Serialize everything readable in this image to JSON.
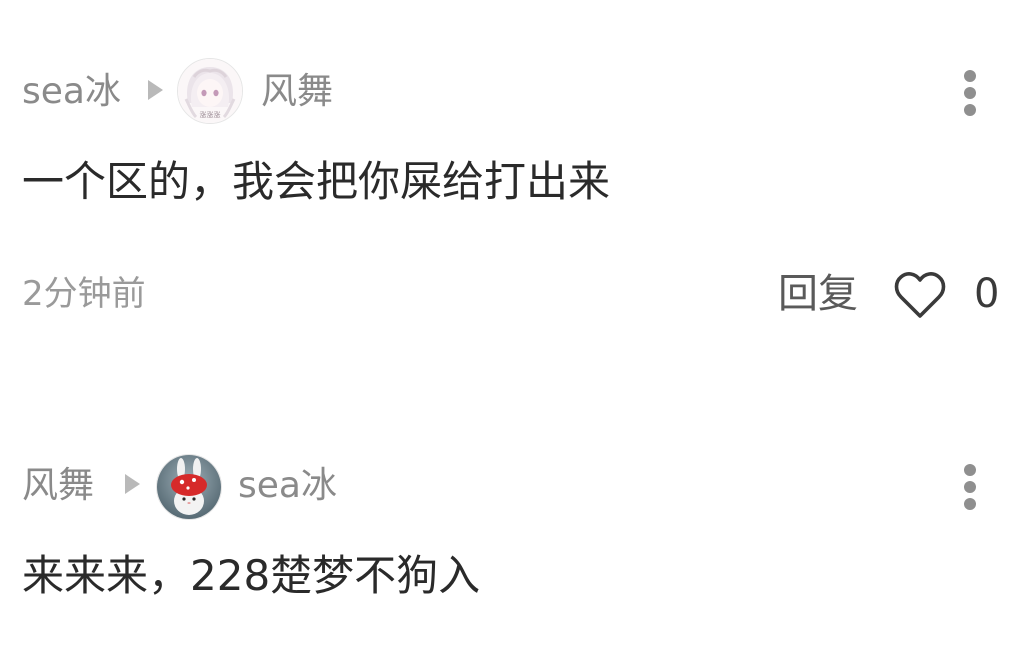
{
  "comments": [
    {
      "author": "sea冰",
      "reply_to": "风舞",
      "avatar_label": "涨涨涨",
      "text": "一个区的，我会把你屎给打出来",
      "time": "2分钟前",
      "reply_label": "回复",
      "like_count": "0",
      "icons": [
        "play-arrow-icon",
        "more-vertical-icon",
        "heart-outline-icon"
      ]
    },
    {
      "author": "风舞",
      "reply_to": "sea冰",
      "text": "来来来，228楚梦不狗入",
      "icons": [
        "play-arrow-icon",
        "more-vertical-icon"
      ]
    }
  ],
  "colors": {
    "username": "#8a8a8a",
    "text": "#2a2a2a",
    "meta": "#9a9a9a",
    "icon": "#8f8f8f"
  }
}
